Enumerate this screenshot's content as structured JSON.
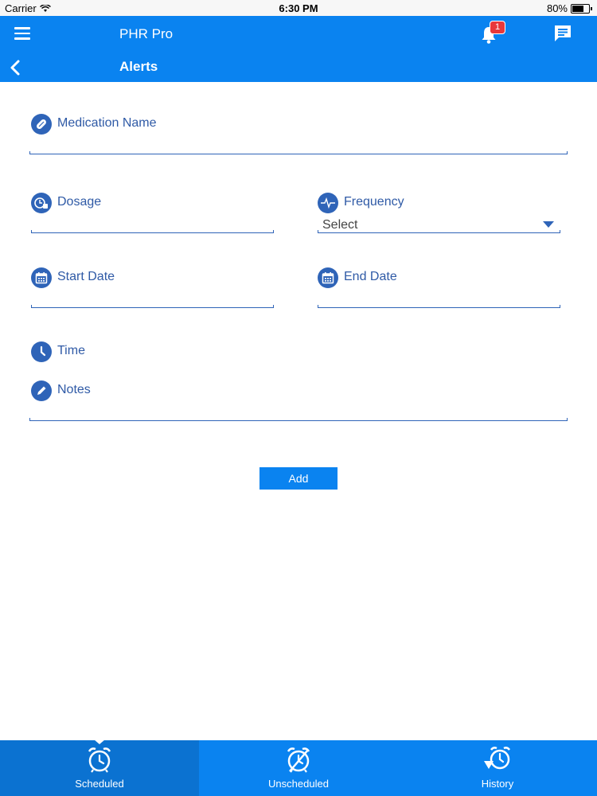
{
  "status_bar": {
    "carrier": "Carrier",
    "time": "6:30 PM",
    "battery": "80%",
    "battery_level": 0.8
  },
  "header": {
    "app_title": "PHR Pro",
    "page_title": "Alerts",
    "notification_count": "1"
  },
  "form": {
    "medication_name": {
      "label": "Medication Name",
      "value": ""
    },
    "dosage": {
      "label": "Dosage",
      "value": ""
    },
    "frequency": {
      "label": "Frequency",
      "selected": "Select"
    },
    "start_date": {
      "label": "Start Date",
      "value": ""
    },
    "end_date": {
      "label": "End Date",
      "value": ""
    },
    "time": {
      "label": "Time"
    },
    "notes": {
      "label": "Notes",
      "value": ""
    },
    "add_label": "Add"
  },
  "tabs": [
    {
      "label": "Scheduled",
      "active": true
    },
    {
      "label": "Unscheduled",
      "active": false
    },
    {
      "label": "History",
      "active": false
    }
  ],
  "colors": {
    "accent": "#0a83f0",
    "icon": "#2f64b8",
    "label": "#2f5aa6",
    "badge": "#e8383b"
  }
}
